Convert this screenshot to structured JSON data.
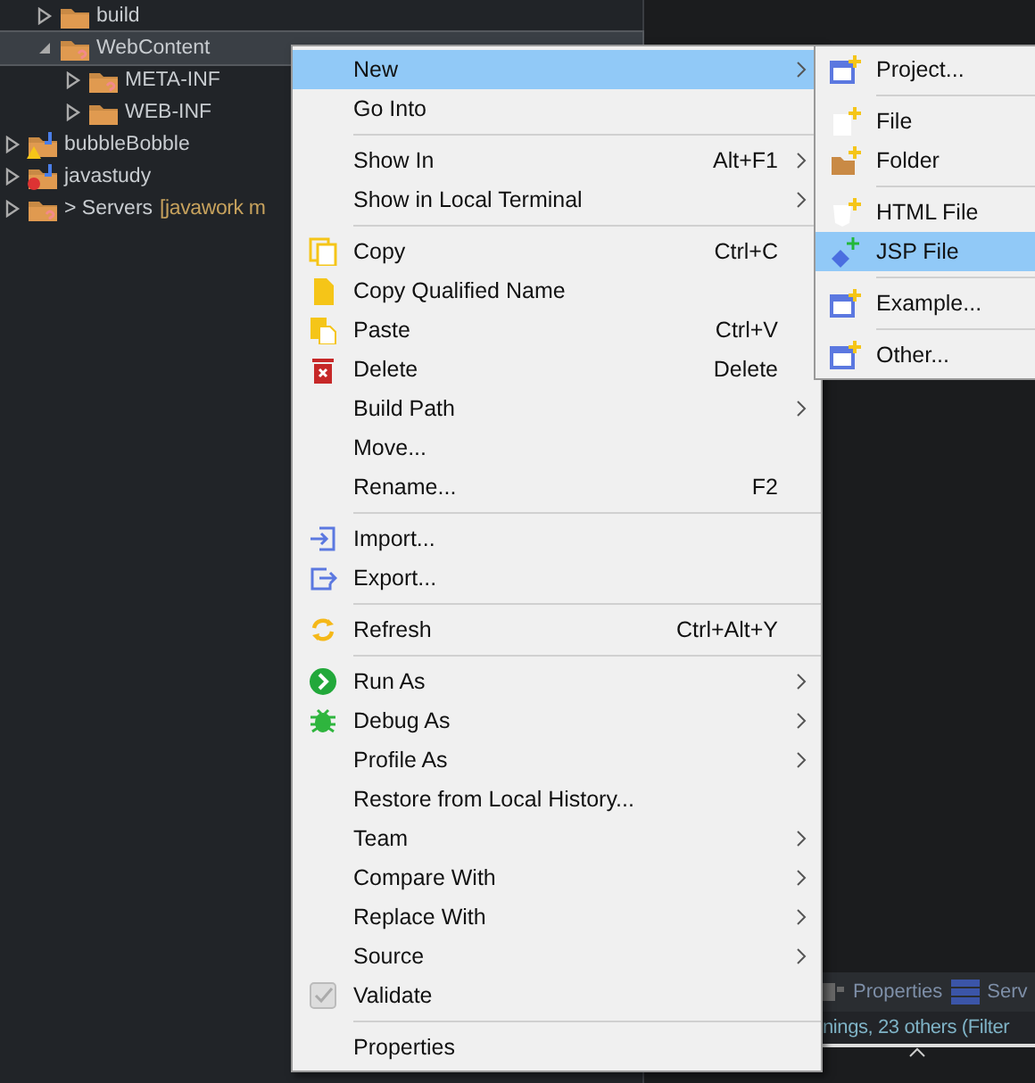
{
  "tree": [
    {
      "label": "build",
      "kind": "folder",
      "expanded": false,
      "selected": false
    },
    {
      "label": "WebContent",
      "kind": "folder-unknown",
      "expanded": true,
      "selected": true,
      "children": [
        {
          "label": "META-INF",
          "kind": "folder-unknown",
          "expanded": false,
          "selected": false
        },
        {
          "label": "WEB-INF",
          "kind": "folder",
          "expanded": false,
          "selected": false
        }
      ]
    },
    {
      "label": "bubbleBobble",
      "kind": "project-warning",
      "expanded": false,
      "selected": false
    },
    {
      "label": "javastudy",
      "kind": "project-error",
      "expanded": false,
      "selected": false
    },
    {
      "label": "> Servers",
      "extra": "[javawork m",
      "kind": "folder-unknown",
      "expanded": false,
      "selected": false
    }
  ],
  "bottom_panel": {
    "tabs": [
      {
        "label": "Properties"
      },
      {
        "label": "Serv"
      }
    ],
    "status": "nings, 23 others (Filter"
  },
  "context_menu": [
    [
      {
        "label": "New",
        "submenu": true,
        "selected": true
      },
      {
        "label": "Go Into",
        "submenu": false,
        "selected": false
      }
    ],
    [
      {
        "label": "Show In",
        "shortcut": "Alt+F1",
        "submenu": true,
        "selected": false
      },
      {
        "label": "Show in Local Terminal",
        "submenu": true,
        "selected": false
      }
    ],
    [
      {
        "label": "Copy",
        "shortcut": "Ctrl+C",
        "submenu": false,
        "kind": "copy",
        "selected": false
      },
      {
        "label": "Copy Qualified Name",
        "submenu": false,
        "kind": "document",
        "selected": false
      },
      {
        "label": "Paste",
        "shortcut": "Ctrl+V",
        "submenu": false,
        "kind": "paste",
        "selected": false
      },
      {
        "label": "Delete",
        "shortcut": "Delete",
        "submenu": false,
        "kind": "trash",
        "selected": false
      },
      {
        "label": "Build Path",
        "submenu": true,
        "selected": false
      },
      {
        "label": "Move...",
        "submenu": false,
        "selected": false
      },
      {
        "label": "Rename...",
        "shortcut": "F2",
        "submenu": false,
        "selected": false
      }
    ],
    [
      {
        "label": "Import...",
        "submenu": false,
        "kind": "import",
        "selected": false
      },
      {
        "label": "Export...",
        "submenu": false,
        "kind": "export",
        "selected": false
      }
    ],
    [
      {
        "label": "Refresh",
        "shortcut": "Ctrl+Alt+Y",
        "submenu": false,
        "kind": "refresh",
        "selected": false
      }
    ],
    [
      {
        "label": "Run As",
        "submenu": true,
        "kind": "run",
        "selected": false
      },
      {
        "label": "Debug As",
        "submenu": true,
        "kind": "bug",
        "selected": false
      },
      {
        "label": "Profile As",
        "submenu": true,
        "selected": false
      },
      {
        "label": "Restore from Local History...",
        "submenu": false,
        "selected": false
      },
      {
        "label": "Team",
        "submenu": true,
        "selected": false
      },
      {
        "label": "Compare With",
        "submenu": true,
        "selected": false
      },
      {
        "label": "Replace With",
        "submenu": true,
        "selected": false
      },
      {
        "label": "Source",
        "submenu": true,
        "selected": false
      },
      {
        "label": "Validate",
        "submenu": false,
        "kind": "checkbox",
        "selected": false
      }
    ],
    [
      {
        "label": "Properties",
        "submenu": false,
        "selected": false
      }
    ]
  ],
  "new_submenu": [
    [
      {
        "label": "Project...",
        "kind": "window",
        "selected": false
      }
    ],
    [
      {
        "label": "File",
        "kind": "file",
        "selected": false
      },
      {
        "label": "Folder",
        "kind": "folder",
        "selected": false
      }
    ],
    [
      {
        "label": "HTML File",
        "kind": "html",
        "selected": false
      },
      {
        "label": "JSP File",
        "kind": "diamond",
        "selected": true
      }
    ],
    [
      {
        "label": "Example...",
        "kind": "window",
        "selected": false
      }
    ],
    [
      {
        "label": "Other...",
        "kind": "window",
        "selected": false
      }
    ]
  ]
}
